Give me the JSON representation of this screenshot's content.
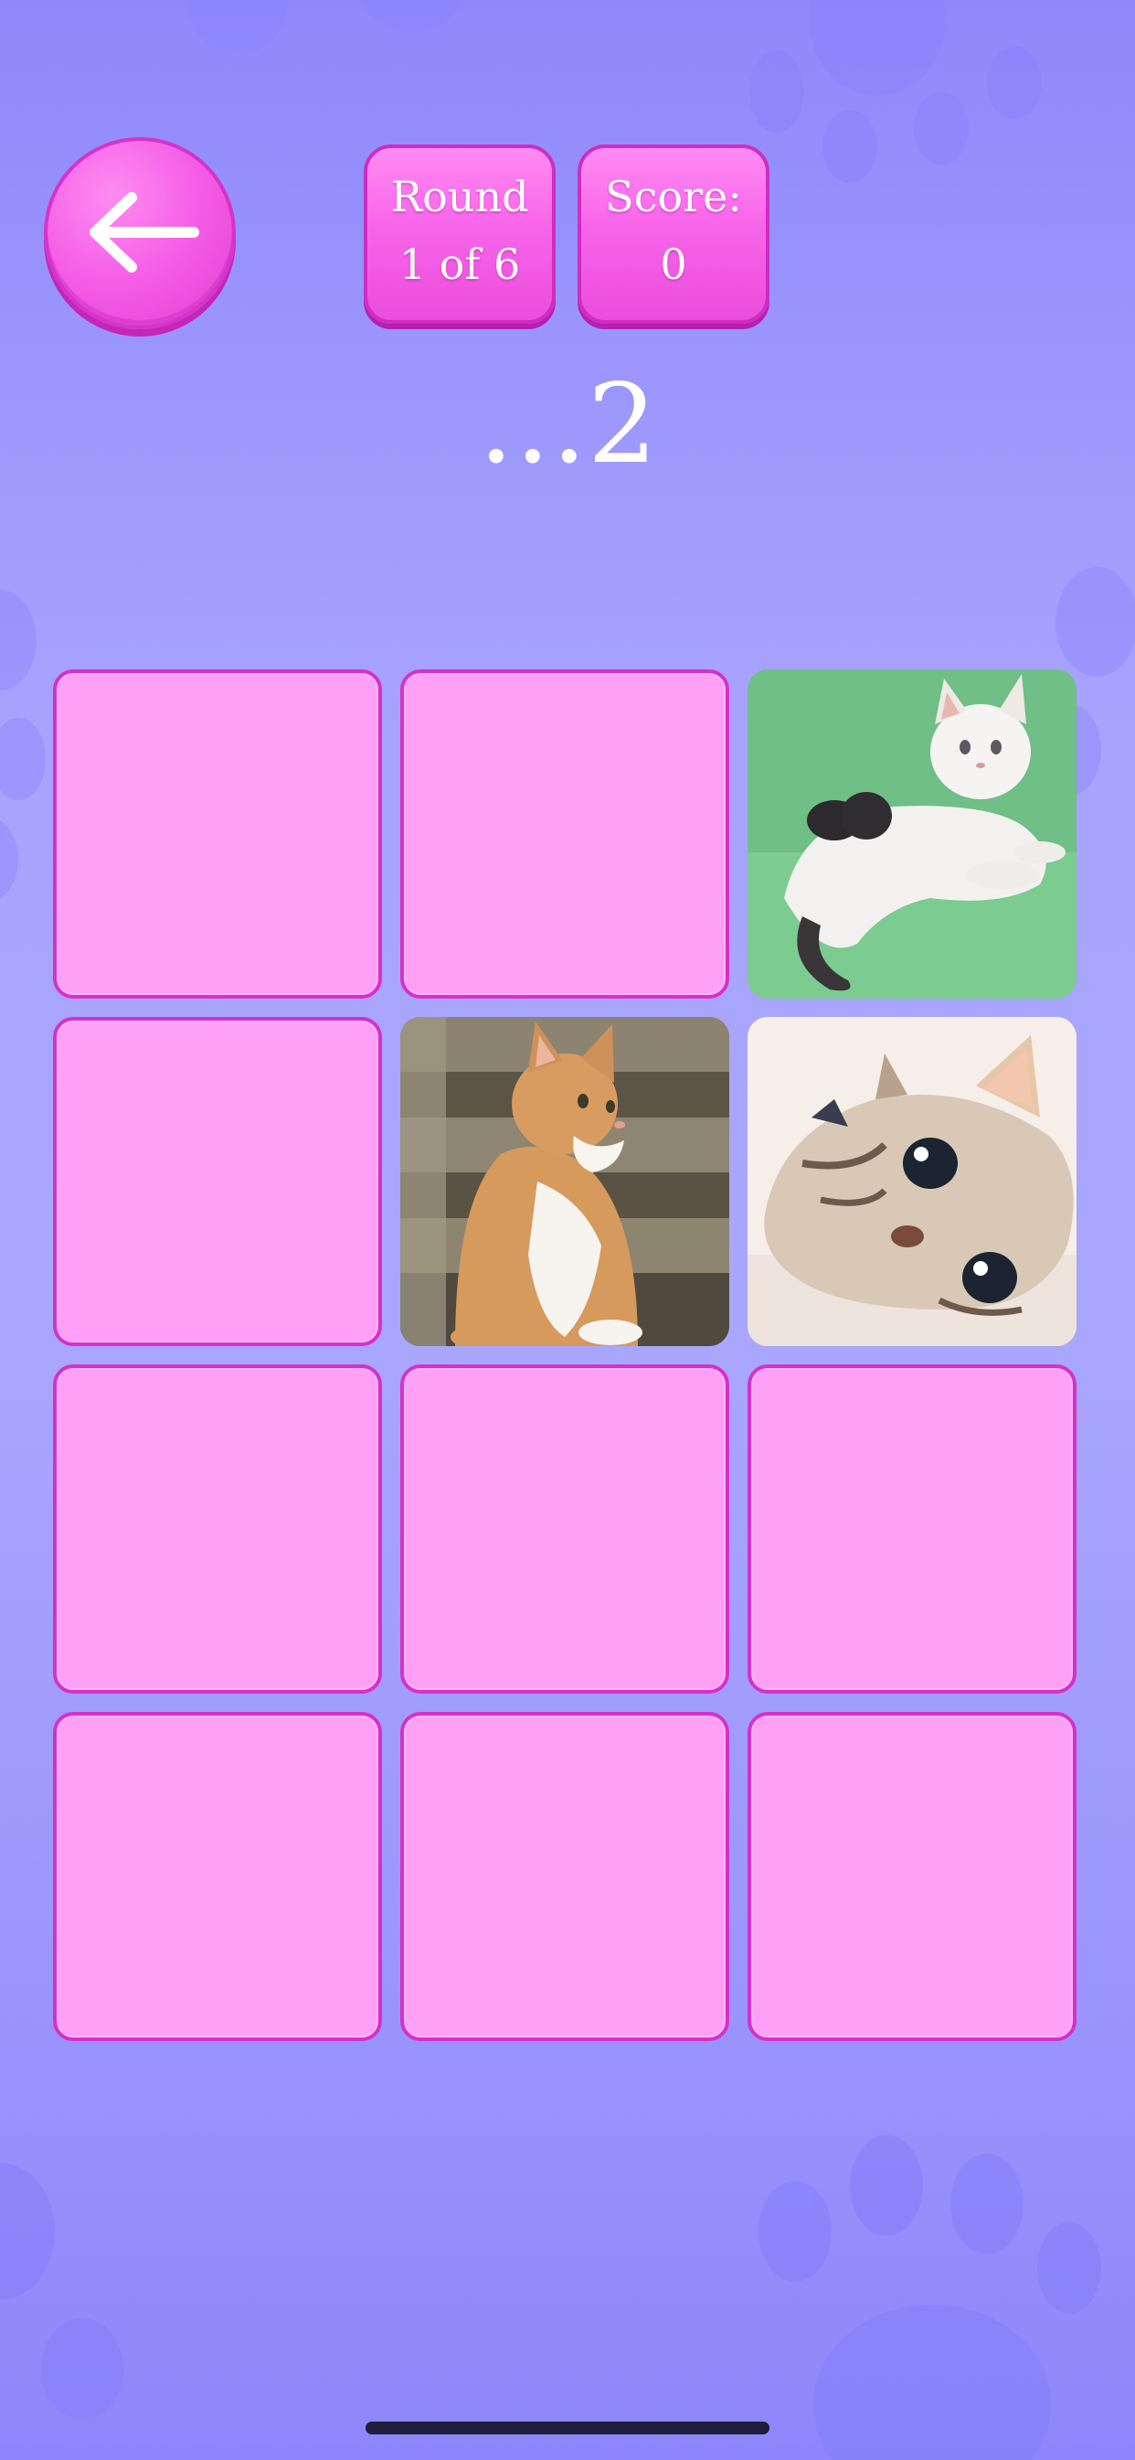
{
  "header": {
    "back_button": {
      "icon": "arrow-left-icon"
    },
    "round": {
      "label": "Round",
      "value": "1 of 6"
    },
    "score": {
      "label": "Score:",
      "value": "0"
    }
  },
  "countdown": "…2",
  "board": {
    "cards": [
      {
        "state": "hidden"
      },
      {
        "state": "hidden"
      },
      {
        "state": "revealed",
        "image": "white-kitten-on-green-floor"
      },
      {
        "state": "hidden"
      },
      {
        "state": "revealed",
        "image": "orange-cat-sitting-on-couch"
      },
      {
        "state": "revealed",
        "image": "tabby-kitten-lying-down"
      },
      {
        "state": "hidden"
      },
      {
        "state": "hidden"
      },
      {
        "state": "hidden"
      },
      {
        "state": "hidden"
      },
      {
        "state": "hidden"
      },
      {
        "state": "hidden"
      }
    ]
  },
  "colors": {
    "background": "#a9a6fd",
    "card_face_down": "#ff9ff5",
    "card_border": "#d82fca",
    "button": "#f45de6"
  }
}
